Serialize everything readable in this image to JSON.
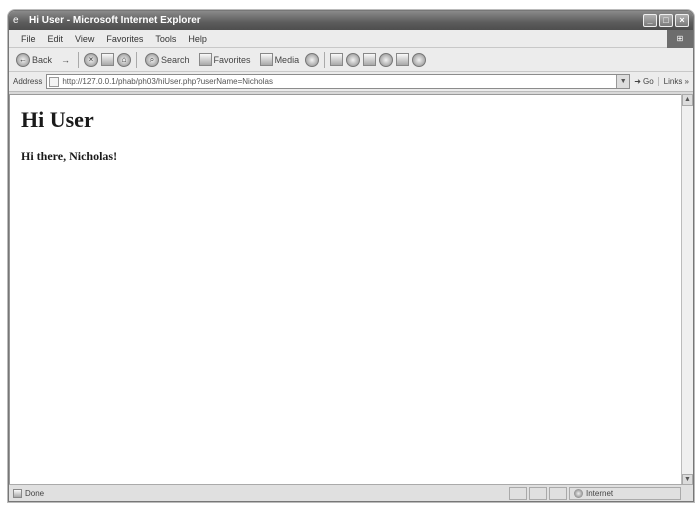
{
  "window": {
    "title": "Hi User - Microsoft Internet Explorer",
    "controls": [
      "_",
      "□",
      "×"
    ]
  },
  "menubar": {
    "items": [
      "File",
      "Edit",
      "View",
      "Favorites",
      "Tools",
      "Help"
    ]
  },
  "toolbar": {
    "back_label": "Back",
    "forward_label": "→",
    "search_label": "Search",
    "favorites_label": "Favorites",
    "media_label": "Media"
  },
  "addressbar": {
    "label": "Address",
    "url": "http://127.0.0.1/phab/ph03/hiUser.php?userName=Nicholas",
    "go_label": "Go",
    "links_label": "Links »"
  },
  "page": {
    "heading": "Hi User",
    "subheading": "Hi there, Nicholas!"
  },
  "statusbar": {
    "status_text": "Done",
    "zone_text": "Internet"
  }
}
